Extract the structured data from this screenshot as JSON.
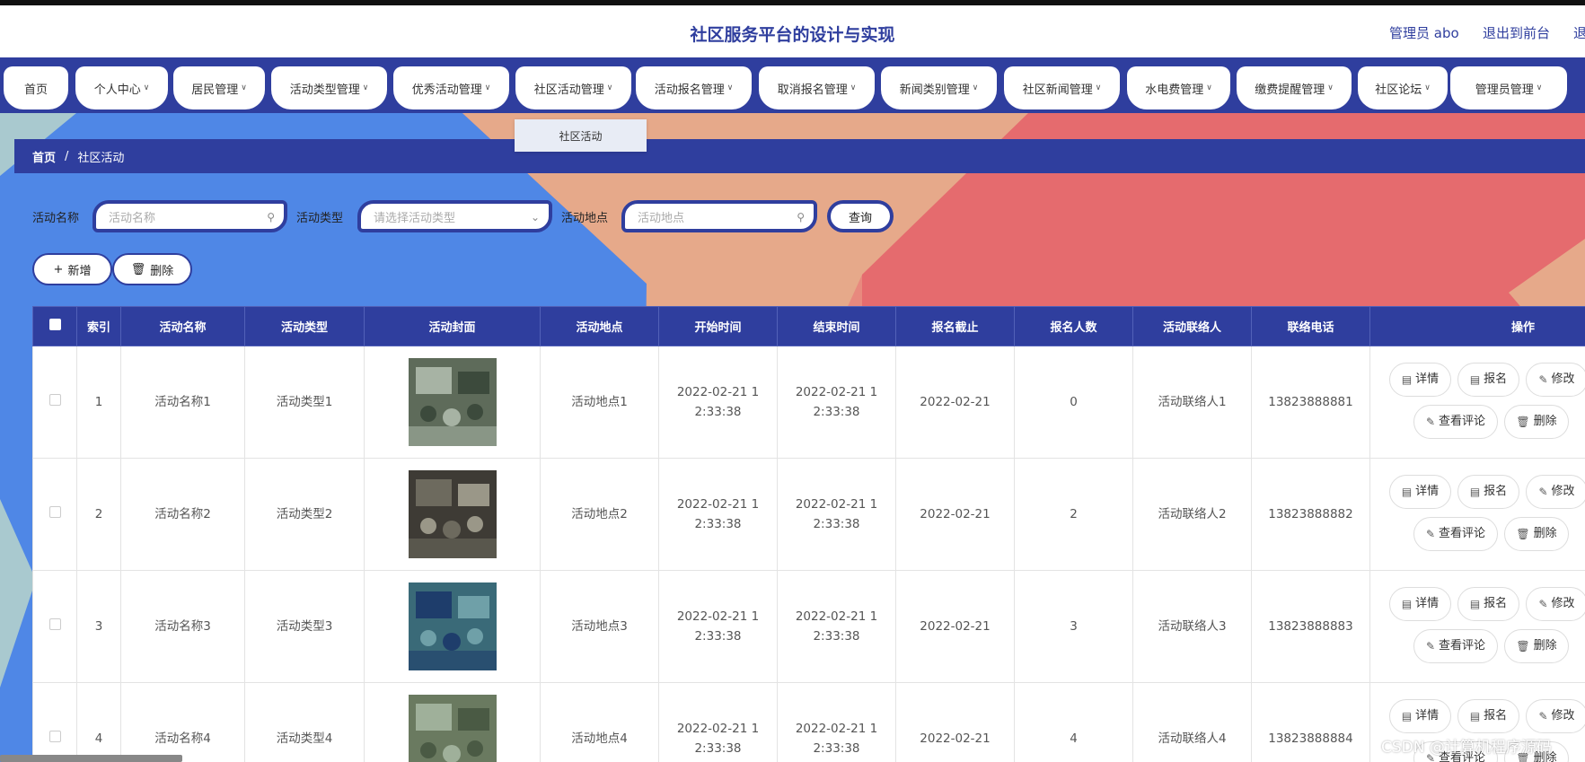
{
  "header": {
    "title": "社区服务平台的设计与实现",
    "admin_label": "管理员 abo",
    "to_front": "退出到前台",
    "logout": "退出登录"
  },
  "nav": {
    "items": [
      {
        "label": "首页",
        "chevron": false
      },
      {
        "label": "个人中心",
        "chevron": true
      },
      {
        "label": "居民管理",
        "chevron": true
      },
      {
        "label": "活动类型管理",
        "chevron": true
      },
      {
        "label": "优秀活动管理",
        "chevron": true
      },
      {
        "label": "社区活动管理",
        "chevron": true
      },
      {
        "label": "活动报名管理",
        "chevron": true
      },
      {
        "label": "取消报名管理",
        "chevron": true
      },
      {
        "label": "新闻类别管理",
        "chevron": true
      },
      {
        "label": "社区新闻管理",
        "chevron": true
      },
      {
        "label": "水电费管理",
        "chevron": true
      },
      {
        "label": "缴费提醒管理",
        "chevron": true
      },
      {
        "label": "社区论坛",
        "chevron": true
      },
      {
        "label": "管理员管理",
        "chevron": true
      }
    ],
    "dropdown_item": "社区活动"
  },
  "breadcrumb": {
    "home": "首页",
    "separator": "/",
    "current": "社区活动"
  },
  "search": {
    "name_label": "活动名称",
    "name_placeholder": "活动名称",
    "type_label": "活动类型",
    "type_placeholder": "请选择活动类型",
    "place_label": "活动地点",
    "place_placeholder": "活动地点",
    "query_button": "查询"
  },
  "actions": {
    "add_label": "新增",
    "delete_label": "删除"
  },
  "table": {
    "headers": [
      "索引",
      "活动名称",
      "活动类型",
      "活动封面",
      "活动地点",
      "开始时间",
      "结束时间",
      "报名截止",
      "报名人数",
      "活动联络人",
      "联络电话",
      "操作"
    ],
    "rows": [
      {
        "index": "1",
        "name": "活动名称1",
        "type": "活动类型1",
        "place": "活动地点1",
        "start": "2022-02-21 12:33:38",
        "end": "2022-02-21 12:33:38",
        "deadline": "2022-02-21",
        "count": "0",
        "contact": "活动联络人1",
        "phone": "13823888881"
      },
      {
        "index": "2",
        "name": "活动名称2",
        "type": "活动类型2",
        "place": "活动地点2",
        "start": "2022-02-21 12:33:38",
        "end": "2022-02-21 12:33:38",
        "deadline": "2022-02-21",
        "count": "2",
        "contact": "活动联络人2",
        "phone": "13823888882"
      },
      {
        "index": "3",
        "name": "活动名称3",
        "type": "活动类型3",
        "place": "活动地点3",
        "start": "2022-02-21 12:33:38",
        "end": "2022-02-21 12:33:38",
        "deadline": "2022-02-21",
        "count": "3",
        "contact": "活动联络人3",
        "phone": "13823888883"
      },
      {
        "index": "4",
        "name": "活动名称4",
        "type": "活动类型4",
        "place": "活动地点4",
        "start": "2022-02-21 12:33:38",
        "end": "2022-02-21 12:33:38",
        "deadline": "2022-02-21",
        "count": "4",
        "contact": "活动联络人4",
        "phone": "13823888884"
      }
    ],
    "row_ops": {
      "detail": "详情",
      "signup": "报名",
      "edit": "修改",
      "comments": "查看评论",
      "delete": "删除"
    }
  },
  "watermark": "CSDN @计算机程序源码",
  "colors": {
    "primary": "#2f3e9e",
    "bg_blue": "#4f87e6",
    "bg_peach": "#e6a98a",
    "bg_red": "#e56b6e",
    "bg_teal": "#a9c9cf"
  }
}
